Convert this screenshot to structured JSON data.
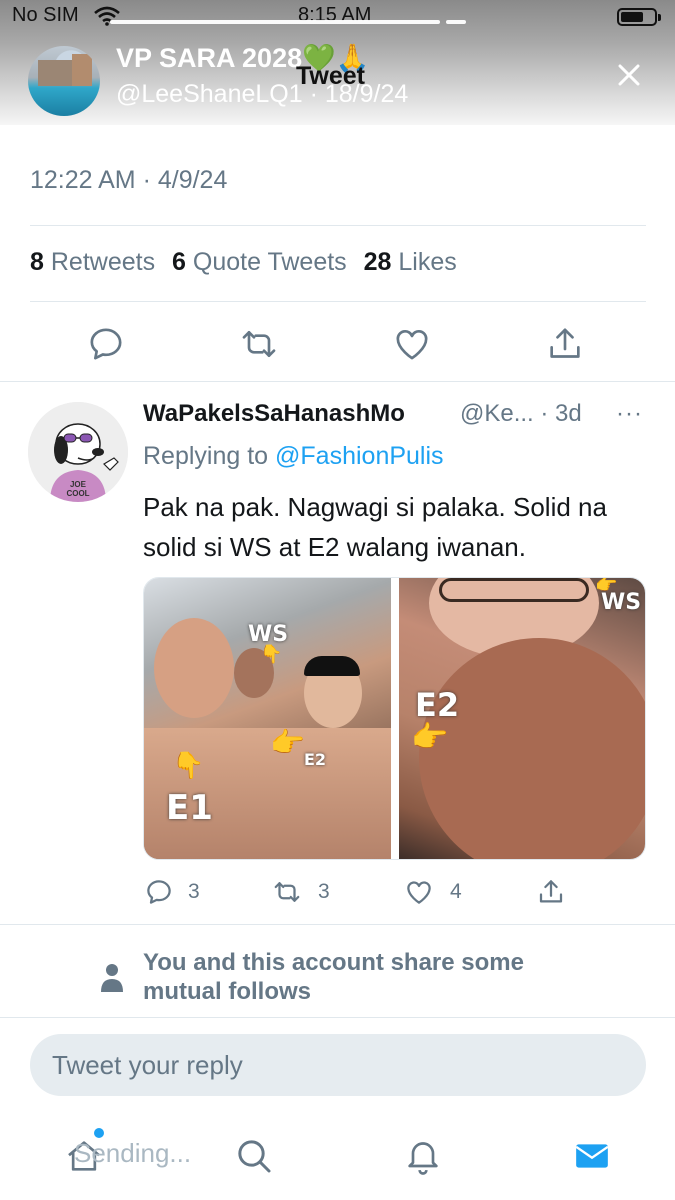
{
  "status_bar": {
    "carrier": "No SIM",
    "time": "8:15 AM"
  },
  "story": {
    "account_name": "VP SARA 2028💚🙏",
    "account_meta": "@LeeShaneLQ1 · 18/9/24",
    "screen_title": "Tweet"
  },
  "tweet": {
    "timestamp": "12:22 AM · 4/9/24",
    "retweets_count": "8",
    "retweets_label": "Retweets",
    "quotes_count": "6",
    "quotes_label": "Quote Tweets",
    "likes_count": "28",
    "likes_label": "Likes"
  },
  "reply": {
    "display_name": "WaPakelsSaHanashMo",
    "handle_time": "@Ke... · 3d",
    "more": "···",
    "replying_prefix": "Replying to",
    "replying_to": "@FashionPulis",
    "text": "Pak na pak.  Nagwagi si palaka.  Solid na solid si WS at E2 walang iwanan.",
    "avatar_caption": "JOE COOL",
    "photo_labels": {
      "ws_left": "WS",
      "e1": "E1",
      "e2_small": "E2",
      "e2_right": "E2",
      "ws_right": "WS"
    },
    "reply_count": "3",
    "retweet_count": "3",
    "like_count": "4"
  },
  "mutual_follows": "You and this account share some mutual follows",
  "composer": {
    "placeholder": "Tweet your reply"
  },
  "tabbar": {
    "pending_text": "Sending..."
  },
  "colors": {
    "accent": "#1da1f2",
    "secondary_text": "#657786",
    "divider": "#e1e8ed"
  }
}
